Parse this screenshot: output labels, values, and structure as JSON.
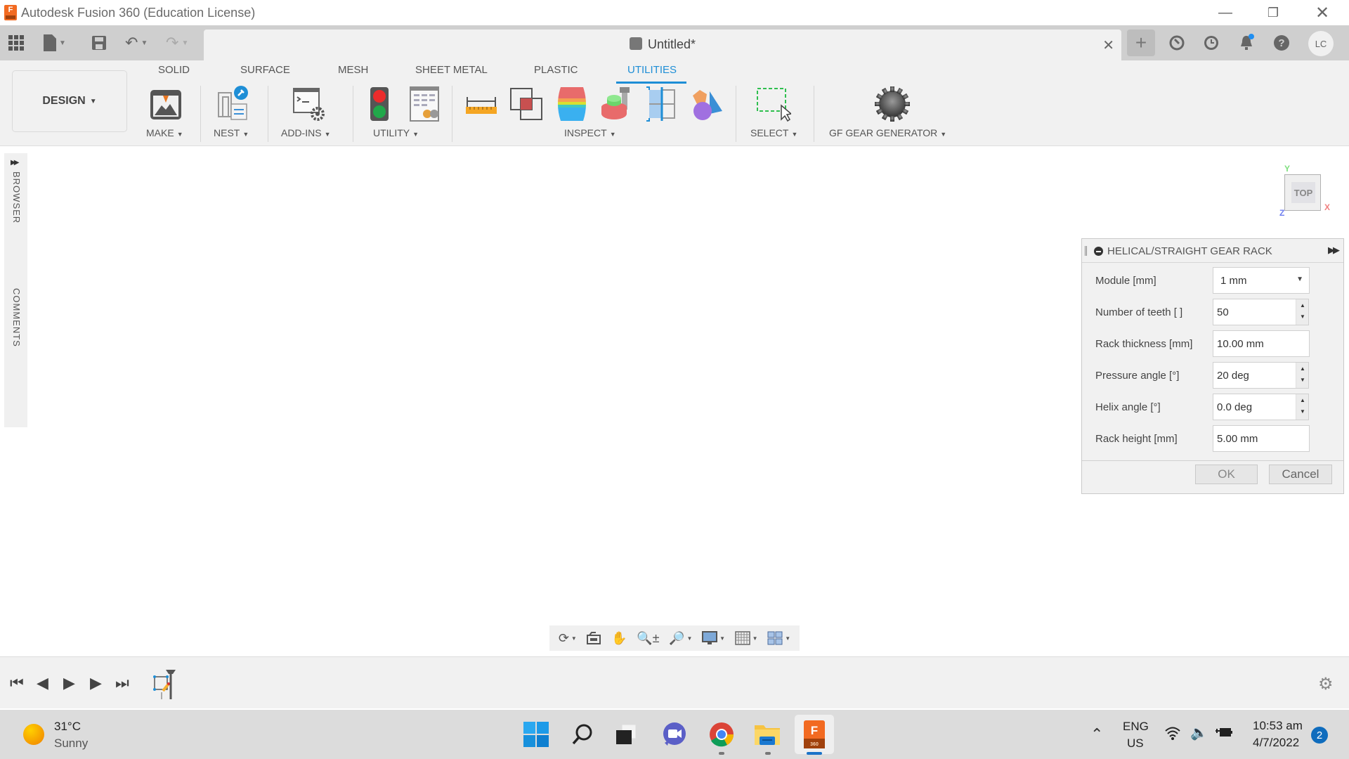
{
  "window": {
    "title": "Autodesk Fusion 360 (Education License)",
    "minimize_icon": "minimize-icon",
    "restore_icon": "restore-icon",
    "close_icon": "close-icon"
  },
  "appbar": {
    "icons": [
      "apps-grid-icon",
      "file-icon",
      "save-icon",
      "undo-icon",
      "redo-icon"
    ],
    "document_title": "Untitled*",
    "document_icon": "component-cube-icon",
    "right_icons": [
      "new-tab-plus-icon",
      "extensions-icon",
      "job-status-clock-icon",
      "notifications-bell-icon",
      "help-icon"
    ],
    "user_initials": "LC"
  },
  "ribbon": {
    "workspace": "DESIGN",
    "tabs": [
      {
        "label": "SOLID",
        "active": false
      },
      {
        "label": "SURFACE",
        "active": false
      },
      {
        "label": "MESH",
        "active": false
      },
      {
        "label": "SHEET METAL",
        "active": false
      },
      {
        "label": "PLASTIC",
        "active": false
      },
      {
        "label": "UTILITIES",
        "active": true
      }
    ],
    "groups": [
      {
        "label": "MAKE",
        "tools": [
          "3d-print-icon"
        ]
      },
      {
        "label": "NEST",
        "tools": [
          "nest-plugin-icon"
        ]
      },
      {
        "label": "ADD-INS",
        "tools": [
          "scripts-addins-icon"
        ]
      },
      {
        "label": "UTILITY",
        "tools": [
          "traffic-light-icon",
          "parameters-table-icon"
        ]
      },
      {
        "label": "INSPECT",
        "tools": [
          "measure-ruler-icon",
          "interference-icon",
          "curvature-zebra-icon",
          "draft-analysis-icon",
          "section-analysis-icon",
          "component-color-icon"
        ]
      },
      {
        "label": "SELECT",
        "tools": [
          "window-select-icon"
        ]
      },
      {
        "label": "GF GEAR GENERATOR",
        "tools": [
          "gear-generator-icon"
        ]
      }
    ],
    "accent_color": "#1e8ed6"
  },
  "side_panel": {
    "browser_label": "BROWSER",
    "comments_label": "COMMENTS"
  },
  "viewcube": {
    "face": "TOP",
    "axes": {
      "x": "X",
      "y": "Y",
      "z": "Z"
    }
  },
  "dialog": {
    "title": "HELICAL/STRAIGHT GEAR RACK",
    "fields": [
      {
        "label": "Module [mm]",
        "value": "1 mm",
        "type": "select"
      },
      {
        "label": "Number of teeth [ ]",
        "value": "50",
        "type": "spinner"
      },
      {
        "label": "Rack thickness [mm]",
        "value": "10.00 mm",
        "type": "text"
      },
      {
        "label": "Pressure angle [°]",
        "value": "20 deg",
        "type": "spinner"
      },
      {
        "label": "Helix angle [°]",
        "value": "0.0 deg",
        "type": "spinner"
      },
      {
        "label": "Rack height [mm]",
        "value": "5.00 mm",
        "type": "text"
      }
    ],
    "ok_label": "OK",
    "cancel_label": "Cancel"
  },
  "navbar": {
    "tools": [
      "orbit-icon",
      "look-at-icon",
      "pan-hand-icon",
      "zoom-icon",
      "zoom-window-icon",
      "display-settings-icon",
      "grid-icon",
      "viewports-icon"
    ]
  },
  "timeline": {
    "controls": [
      "go-to-start-icon",
      "step-back-icon",
      "play-icon",
      "step-forward-icon",
      "go-to-end-icon"
    ],
    "marker_icon": "timeline-sketch-marker-icon",
    "settings_icon": "settings-gear-icon"
  },
  "taskbar": {
    "weather": {
      "temperature": "31°C",
      "condition": "Sunny"
    },
    "apps": [
      "windows-start-icon",
      "search-icon",
      "task-view-icon",
      "teams-chat-icon",
      "chrome-icon",
      "file-explorer-icon",
      "fusion-360-icon"
    ],
    "language": {
      "line1": "ENG",
      "line2": "US"
    },
    "time": "10:53 am",
    "date": "4/7/2022",
    "notification_count": "2"
  }
}
